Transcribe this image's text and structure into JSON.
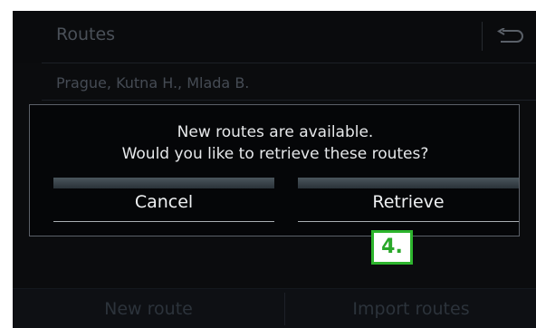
{
  "header": {
    "title": "Routes",
    "back_icon": "return-arrow-icon"
  },
  "route_list": {
    "items": [
      "Prague, Kutna H., Mlada B."
    ]
  },
  "dialog": {
    "message_line1": "New routes are available.",
    "message_line2": "Would you like to retrieve these routes?",
    "cancel_label": "Cancel",
    "retrieve_label": "Retrieve"
  },
  "bottom_bar": {
    "new_route_label": "New route",
    "import_routes_label": "Import routes"
  },
  "annotation": {
    "step_label": "4.",
    "color": "#2db52d"
  }
}
